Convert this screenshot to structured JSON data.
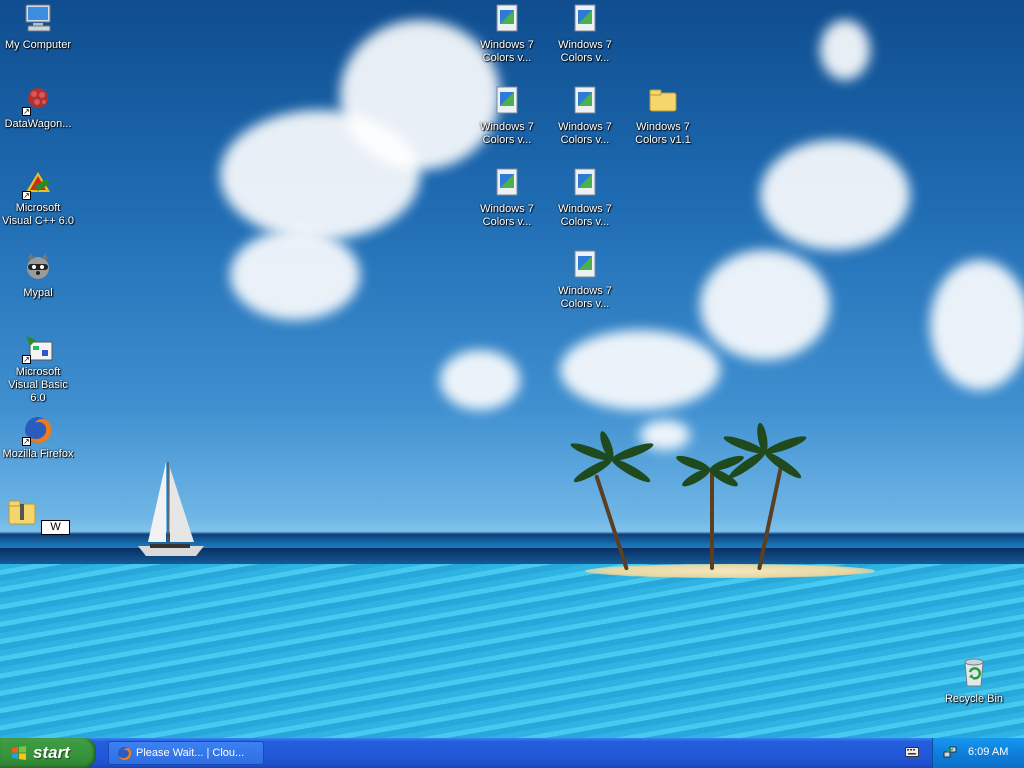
{
  "desktop": {
    "icons": [
      {
        "label": "My Computer"
      },
      {
        "label": "DataWagon..."
      },
      {
        "label": "Microsoft Visual C++ 6.0"
      },
      {
        "label": "Mypal"
      },
      {
        "label": "Microsoft Visual Basic 6.0"
      },
      {
        "label": "Mozilla Firefox"
      },
      {
        "label": "W"
      },
      {
        "label": "Windows 7 Colors v..."
      },
      {
        "label": "Windows 7 Colors v..."
      },
      {
        "label": "Windows 7 Colors v..."
      },
      {
        "label": "Windows 7 Colors v..."
      },
      {
        "label": "Windows 7 Colors v1.1"
      },
      {
        "label": "Windows 7 Colors v..."
      },
      {
        "label": "Windows 7 Colors v..."
      },
      {
        "label": "Windows 7 Colors v..."
      },
      {
        "label": "Recycle Bin"
      }
    ]
  },
  "taskbar": {
    "start_label": "start",
    "task_item_label": "Please Wait... | Clou...",
    "clock": "6:09 AM"
  },
  "colors": {
    "taskbar_blue": "#245edc",
    "start_green": "#3c9b40",
    "tray_blue": "#0f7fdb"
  }
}
